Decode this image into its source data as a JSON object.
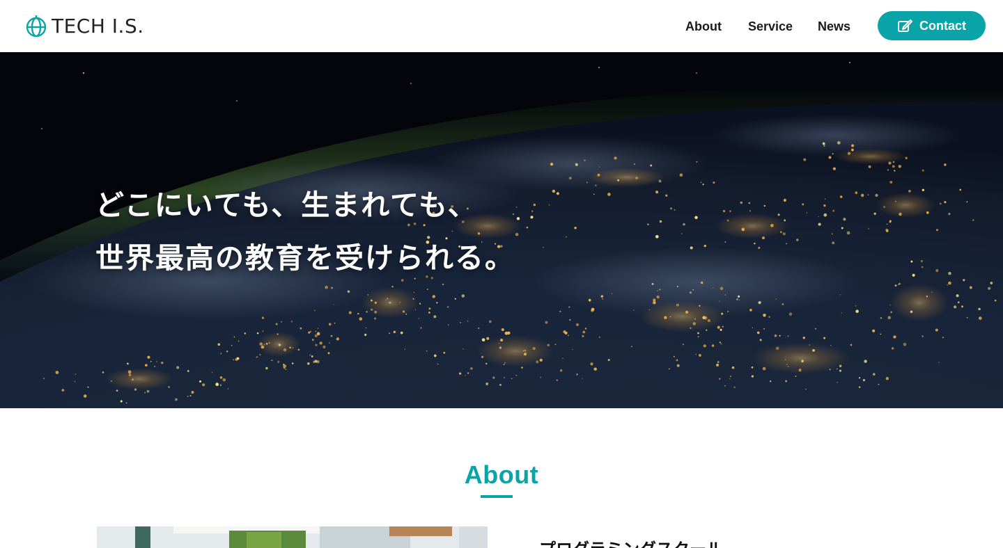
{
  "header": {
    "logo_text": "TECH I.S.",
    "logo_icon": "globe-icon",
    "nav": [
      {
        "label": "About"
      },
      {
        "label": "Service"
      },
      {
        "label": "News"
      }
    ],
    "contact_label": "Contact",
    "contact_icon": "edit-icon"
  },
  "hero": {
    "line1": "どこにいても、生まれても、",
    "line2": "世界最高の教育を受けられる。"
  },
  "about": {
    "title": "About",
    "subtitle": "プログラミングスクール"
  },
  "colors": {
    "accent": "#0aa3a8",
    "text": "#1a1a1a",
    "background": "#ffffff"
  }
}
